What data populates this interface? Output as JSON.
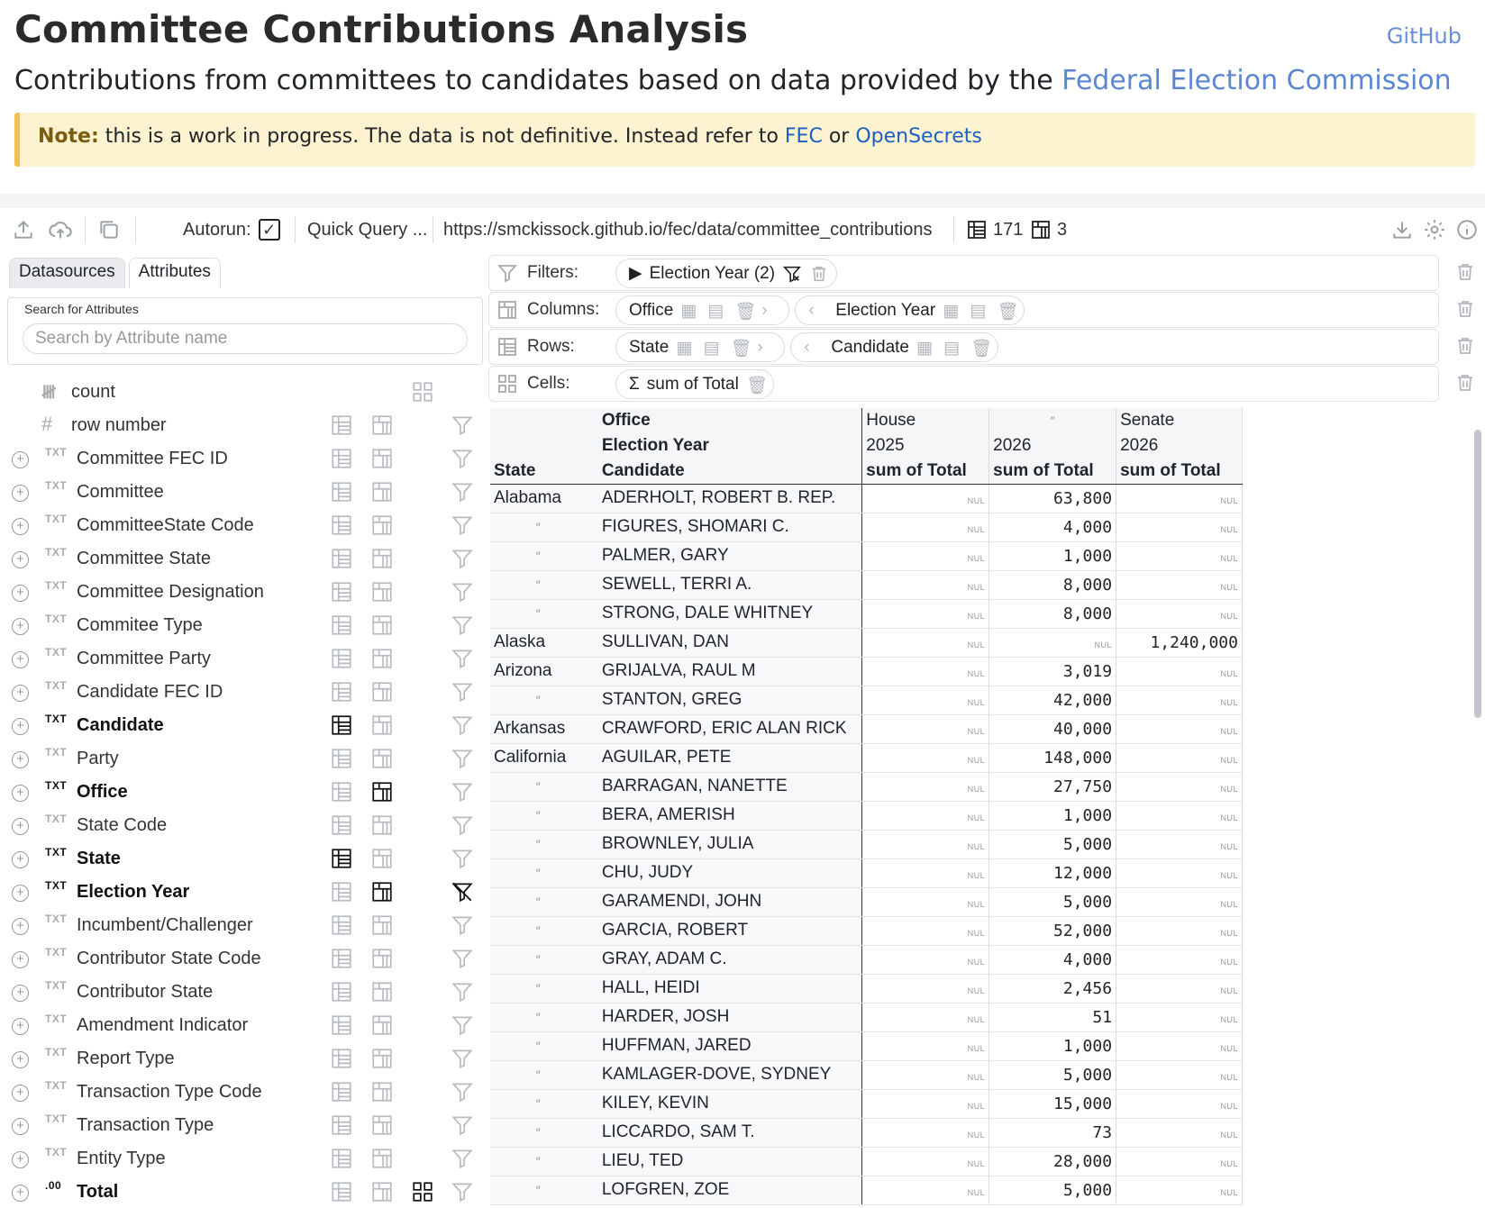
{
  "header": {
    "title": "Committee Contributions Analysis",
    "github": "GitHub",
    "subtitle_prefix": "Contributions from committees to candidates based on data provided by the ",
    "subtitle_link": "Federal Election Commission"
  },
  "note": {
    "label": "Note:",
    "text": " this is a work in progress. The data is not definitive. Instead refer to ",
    "link1": "FEC",
    "or": " or ",
    "link2": "OpenSecrets"
  },
  "toolbar": {
    "autorun_label": "Autorun:",
    "quick_query": "Quick Query ...",
    "url": "https://smckissock.github.io/fec/data/committee_contributions",
    "row_count": "171",
    "col_count": "3"
  },
  "left_panel": {
    "tabs": [
      "Datasources",
      "Attributes"
    ],
    "search_label": "Search for Attributes",
    "search_placeholder": "Search by Attribute name",
    "attributes": [
      {
        "type": "",
        "name": "count"
      },
      {
        "type": "#",
        "name": "row number"
      },
      {
        "type": "TXT",
        "name": "Committee FEC ID"
      },
      {
        "type": "TXT",
        "name": "Committee"
      },
      {
        "type": "TXT",
        "name": "CommitteeState Code"
      },
      {
        "type": "TXT",
        "name": "Committee State"
      },
      {
        "type": "TXT",
        "name": "Committee Designation"
      },
      {
        "type": "TXT",
        "name": "Commitee Type"
      },
      {
        "type": "TXT",
        "name": "Committee Party"
      },
      {
        "type": "TXT",
        "name": "Candidate FEC ID"
      },
      {
        "type": "TXT",
        "name": "Candidate"
      },
      {
        "type": "TXT",
        "name": "Party"
      },
      {
        "type": "TXT",
        "name": "Office"
      },
      {
        "type": "TXT",
        "name": "State Code"
      },
      {
        "type": "TXT",
        "name": "State"
      },
      {
        "type": "TXT",
        "name": "Election Year"
      },
      {
        "type": "TXT",
        "name": "Incumbent/Challenger"
      },
      {
        "type": "TXT",
        "name": "Contributor State Code"
      },
      {
        "type": "TXT",
        "name": "Contributor State"
      },
      {
        "type": "TXT",
        "name": "Amendment Indicator"
      },
      {
        "type": "TXT",
        "name": "Report Type"
      },
      {
        "type": "TXT",
        "name": "Transaction Type Code"
      },
      {
        "type": "TXT",
        "name": "Transaction Type"
      },
      {
        "type": "TXT",
        "name": "Entity Type"
      },
      {
        "type": ".00",
        "name": "Total"
      }
    ]
  },
  "query": {
    "filters_label": "Filters:",
    "columns_label": "Columns:",
    "rows_label": "Rows:",
    "cells_label": "Cells:",
    "filter_chip": "Election Year (2)",
    "column_chips": [
      "Office",
      "Election Year"
    ],
    "row_chips": [
      "State",
      "Candidate"
    ],
    "cell_chip": "sum of Total"
  },
  "pivot": {
    "hdr_office": "Office",
    "hdr_election_year": "Election Year",
    "hdr_state": "State",
    "hdr_candidate": "Candidate",
    "office_values": [
      "House",
      "″",
      "Senate"
    ],
    "year_values": [
      "2025",
      "2026",
      "2026"
    ],
    "measure": "sum of Total",
    "nul": "NUL",
    "ditto": "″",
    "rows": [
      {
        "state": "Alabama",
        "candidate": "ADERHOLT, ROBERT B. REP.",
        "v": [
          null,
          "63,800",
          null
        ]
      },
      {
        "state": "″",
        "candidate": "FIGURES, SHOMARI C.",
        "v": [
          null,
          "4,000",
          null
        ]
      },
      {
        "state": "″",
        "candidate": "PALMER, GARY",
        "v": [
          null,
          "1,000",
          null
        ]
      },
      {
        "state": "″",
        "candidate": "SEWELL, TERRI A.",
        "v": [
          null,
          "8,000",
          null
        ]
      },
      {
        "state": "″",
        "candidate": "STRONG, DALE WHITNEY",
        "v": [
          null,
          "8,000",
          null
        ]
      },
      {
        "state": "Alaska",
        "candidate": "SULLIVAN, DAN",
        "v": [
          null,
          null,
          "1,240,000"
        ]
      },
      {
        "state": "Arizona",
        "candidate": "GRIJALVA, RAUL M",
        "v": [
          null,
          "3,019",
          null
        ]
      },
      {
        "state": "″",
        "candidate": "STANTON, GREG",
        "v": [
          null,
          "42,000",
          null
        ]
      },
      {
        "state": "Arkansas",
        "candidate": "CRAWFORD, ERIC ALAN RICK",
        "v": [
          null,
          "40,000",
          null
        ]
      },
      {
        "state": "California",
        "candidate": "AGUILAR, PETE",
        "v": [
          null,
          "148,000",
          null
        ]
      },
      {
        "state": "″",
        "candidate": "BARRAGAN, NANETTE",
        "v": [
          null,
          "27,750",
          null
        ]
      },
      {
        "state": "″",
        "candidate": "BERA, AMERISH",
        "v": [
          null,
          "1,000",
          null
        ]
      },
      {
        "state": "″",
        "candidate": "BROWNLEY, JULIA",
        "v": [
          null,
          "5,000",
          null
        ]
      },
      {
        "state": "″",
        "candidate": "CHU, JUDY",
        "v": [
          null,
          "12,000",
          null
        ]
      },
      {
        "state": "″",
        "candidate": "GARAMENDI, JOHN",
        "v": [
          null,
          "5,000",
          null
        ]
      },
      {
        "state": "″",
        "candidate": "GARCIA, ROBERT",
        "v": [
          null,
          "52,000",
          null
        ]
      },
      {
        "state": "″",
        "candidate": "GRAY, ADAM C.",
        "v": [
          null,
          "4,000",
          null
        ]
      },
      {
        "state": "″",
        "candidate": "HALL, HEIDI",
        "v": [
          null,
          "2,456",
          null
        ]
      },
      {
        "state": "″",
        "candidate": "HARDER, JOSH",
        "v": [
          null,
          "51",
          null
        ]
      },
      {
        "state": "″",
        "candidate": "HUFFMAN, JARED",
        "v": [
          null,
          "1,000",
          null
        ]
      },
      {
        "state": "″",
        "candidate": "KAMLAGER-DOVE, SYDNEY",
        "v": [
          null,
          "5,000",
          null
        ]
      },
      {
        "state": "″",
        "candidate": "KILEY, KEVIN",
        "v": [
          null,
          "15,000",
          null
        ]
      },
      {
        "state": "″",
        "candidate": "LICCARDO, SAM T.",
        "v": [
          null,
          "73",
          null
        ]
      },
      {
        "state": "″",
        "candidate": "LIEU, TED",
        "v": [
          null,
          "28,000",
          null
        ]
      },
      {
        "state": "″",
        "candidate": "LOFGREN, ZOE",
        "v": [
          null,
          "5,000",
          null
        ]
      }
    ]
  }
}
